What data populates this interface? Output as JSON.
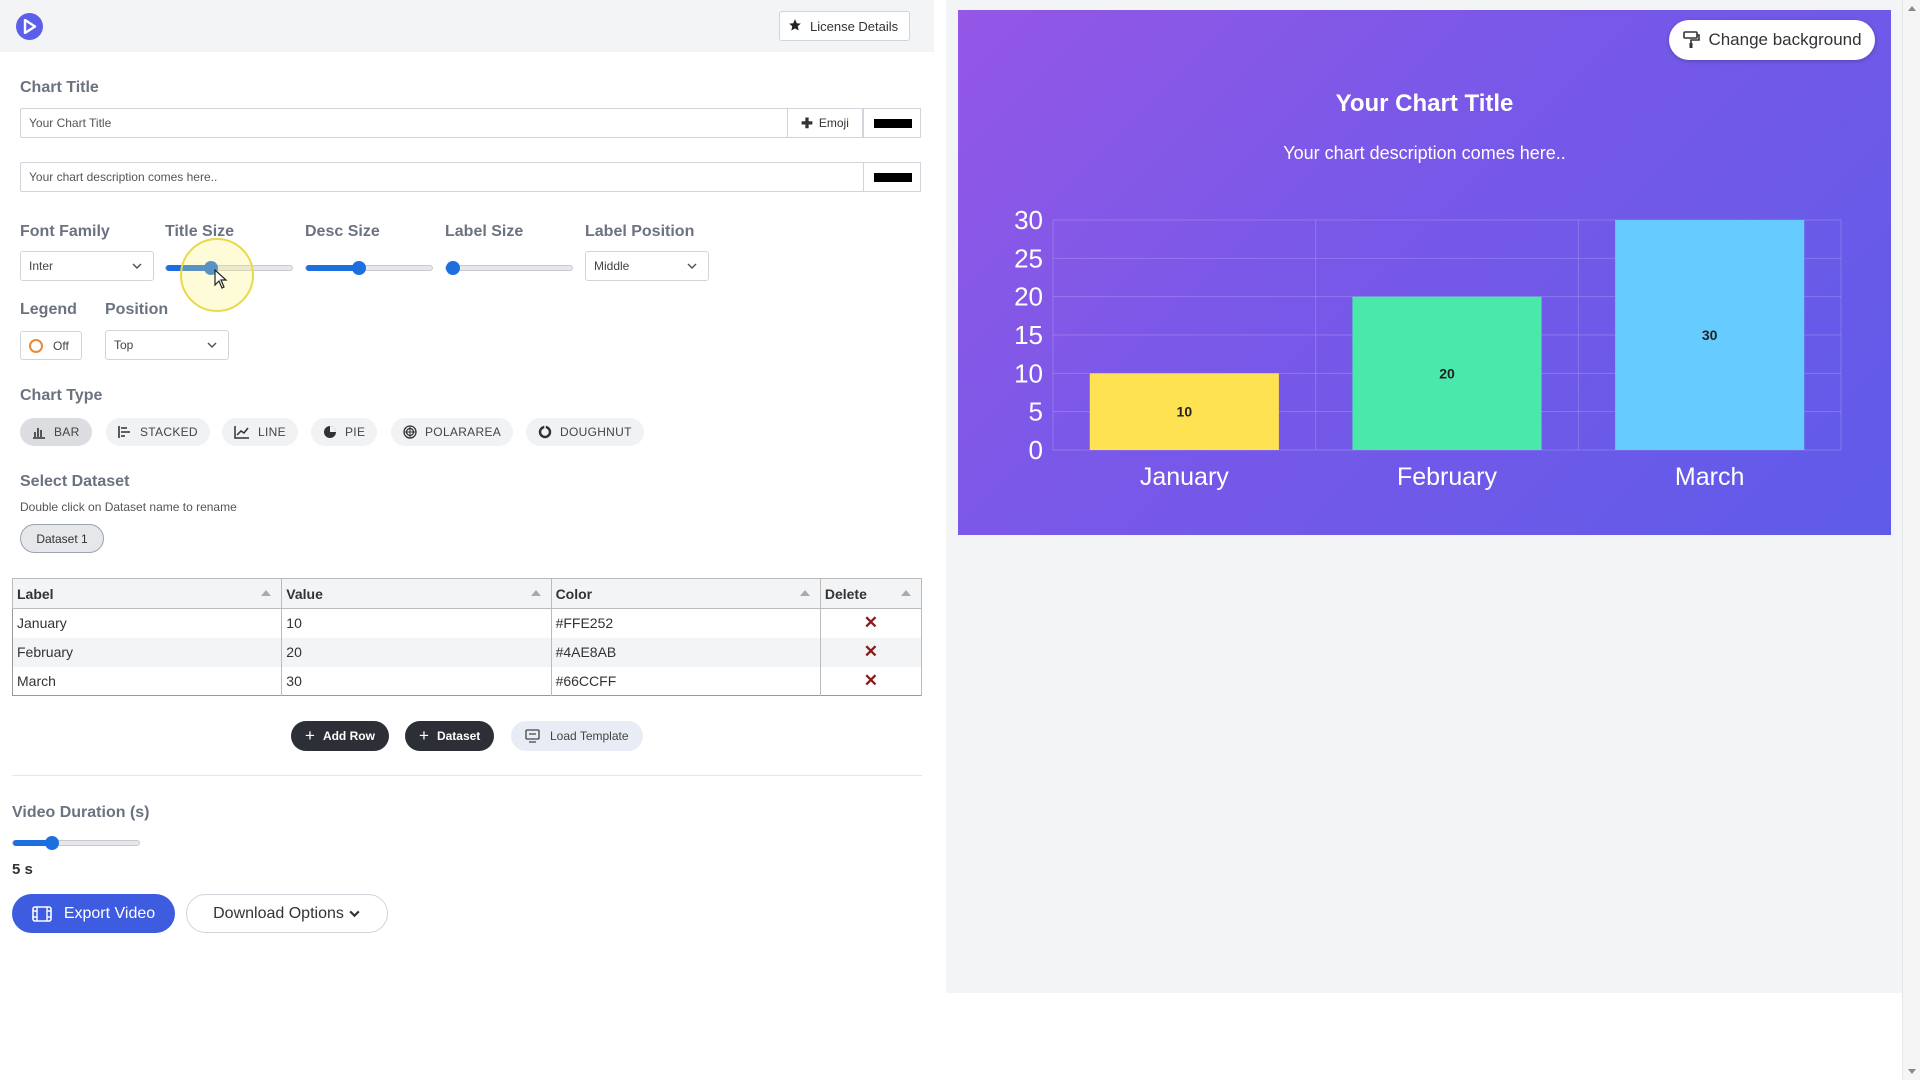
{
  "header": {
    "license_label": "License Details"
  },
  "title_section": {
    "label": "Chart Title",
    "title_value": "Your Chart Title",
    "emoji_label": "Emoji",
    "description_value": "Your chart description comes here..",
    "title_color": "#000000",
    "desc_color": "#000000"
  },
  "controls": {
    "font_family_label": "Font Family",
    "font_family_value": "Inter",
    "title_size_label": "Title Size",
    "title_size_level": 0.36,
    "desc_size_label": "Desc Size",
    "desc_size_level": 0.42,
    "label_size_label": "Label Size",
    "label_size_level": 0.0,
    "label_position_label": "Label Position",
    "label_position_value": "Middle",
    "legend_label": "Legend",
    "legend_value": "Off",
    "position_label": "Position",
    "position_value": "Top"
  },
  "chart_type": {
    "label": "Chart Type",
    "options": [
      "BAR",
      "STACKED",
      "LINE",
      "PIE",
      "POLARAREA",
      "DOUGHNUT"
    ],
    "selected": "BAR"
  },
  "dataset": {
    "label": "Select Dataset",
    "hint": "Double click on Dataset name to rename",
    "selected": "Dataset 1"
  },
  "table": {
    "headers": [
      "Label",
      "Value",
      "Color",
      "Delete"
    ],
    "rows": [
      {
        "label": "January",
        "value": "10",
        "color": "#FFE252"
      },
      {
        "label": "February",
        "value": "20",
        "color": "#4AE8AB"
      },
      {
        "label": "March",
        "value": "30",
        "color": "#66CCFF"
      }
    ]
  },
  "actions": {
    "add_row": "Add Row",
    "dataset": "Dataset",
    "load_template": "Load Template"
  },
  "video": {
    "duration_label": "Video Duration (s)",
    "duration_level": 0.31,
    "duration_value": "5 s",
    "export_label": "Export Video",
    "download_label": "Download Options"
  },
  "preview": {
    "change_bg_label": "Change background",
    "title": "Your Chart Title",
    "description": "Your chart description comes here.."
  },
  "chart_data": {
    "type": "bar",
    "categories": [
      "January",
      "February",
      "March"
    ],
    "values": [
      10,
      20,
      30
    ],
    "colors": [
      "#FFE252",
      "#4AE8AB",
      "#66CCFF"
    ],
    "title": "Your Chart Title",
    "subtitle": "Your chart description comes here..",
    "ylim": [
      0,
      30
    ],
    "yticks": [
      0,
      5,
      10,
      15,
      20,
      25,
      30
    ],
    "grid": true,
    "legend": "off",
    "data_labels": true
  }
}
